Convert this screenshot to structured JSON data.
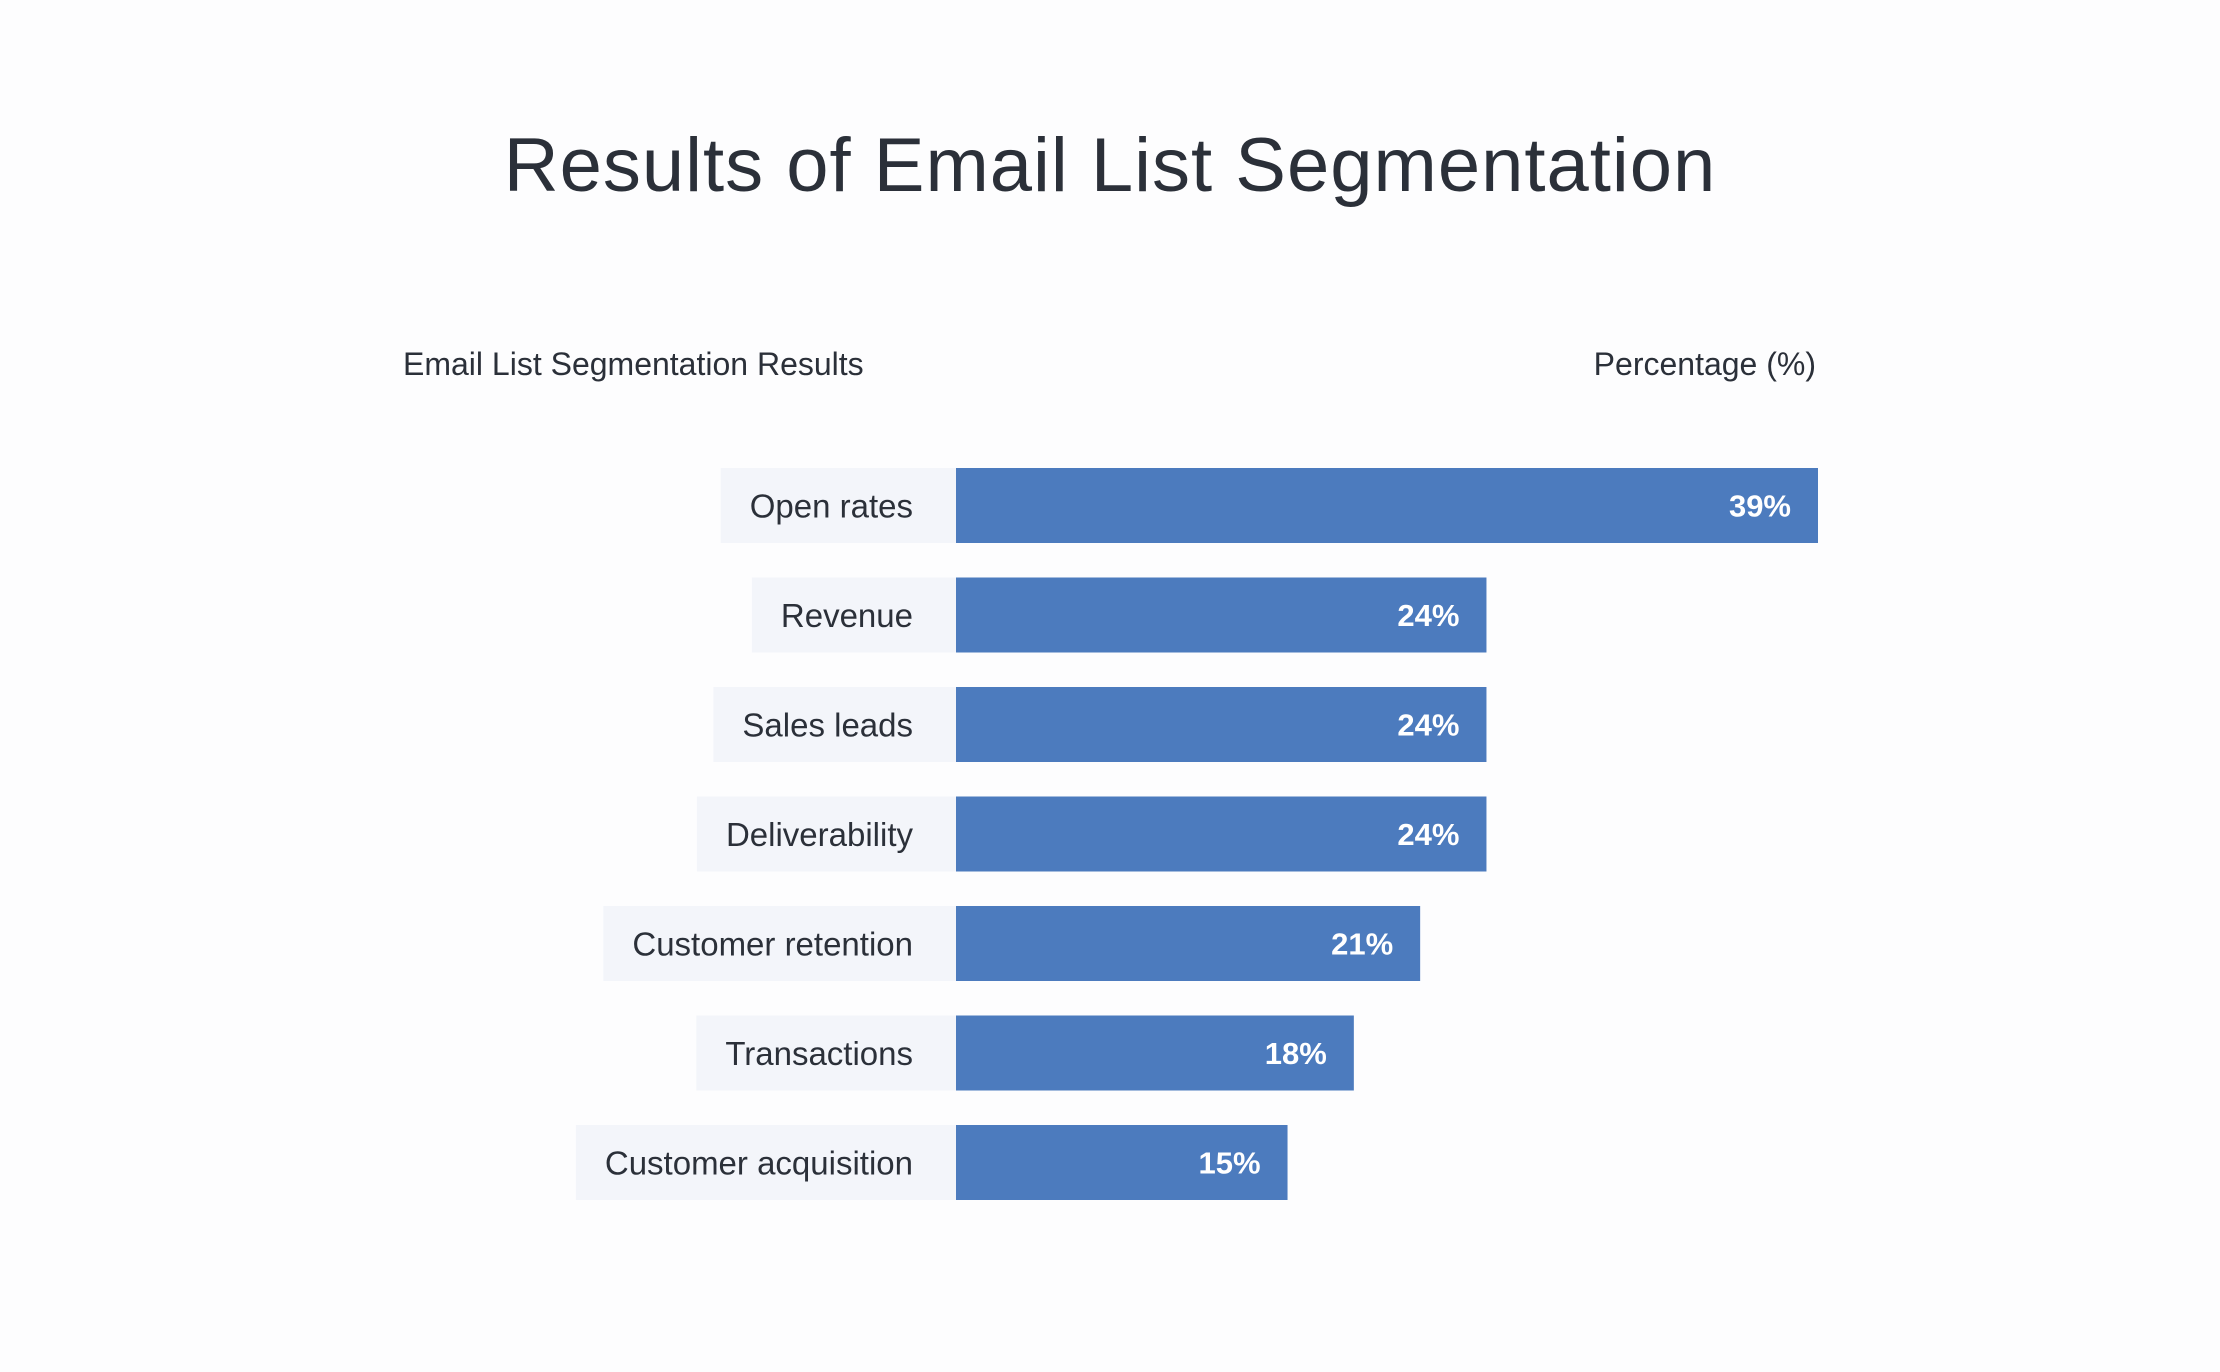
{
  "chart_data": {
    "type": "bar",
    "orientation": "horizontal",
    "title": "Results of Email List Segmentation",
    "category_header": "Email List Segmentation Results",
    "value_header": "Percentage (%)",
    "categories": [
      "Open rates",
      "Revenue",
      "Sales leads",
      "Deliverability",
      "Customer retention",
      "Transactions",
      "Customer acquisition"
    ],
    "values": [
      39,
      24,
      24,
      24,
      21,
      18,
      15
    ],
    "value_labels": [
      "39%",
      "24%",
      "24%",
      "24%",
      "21%",
      "18%",
      "15%"
    ],
    "xlim": [
      0,
      39
    ],
    "grid": false,
    "legend": "none",
    "colors": {
      "bar": "#4c7bbe",
      "label_bg": "#f3f5fa",
      "text": "#2b3039",
      "value_text": "#ffffff"
    }
  }
}
